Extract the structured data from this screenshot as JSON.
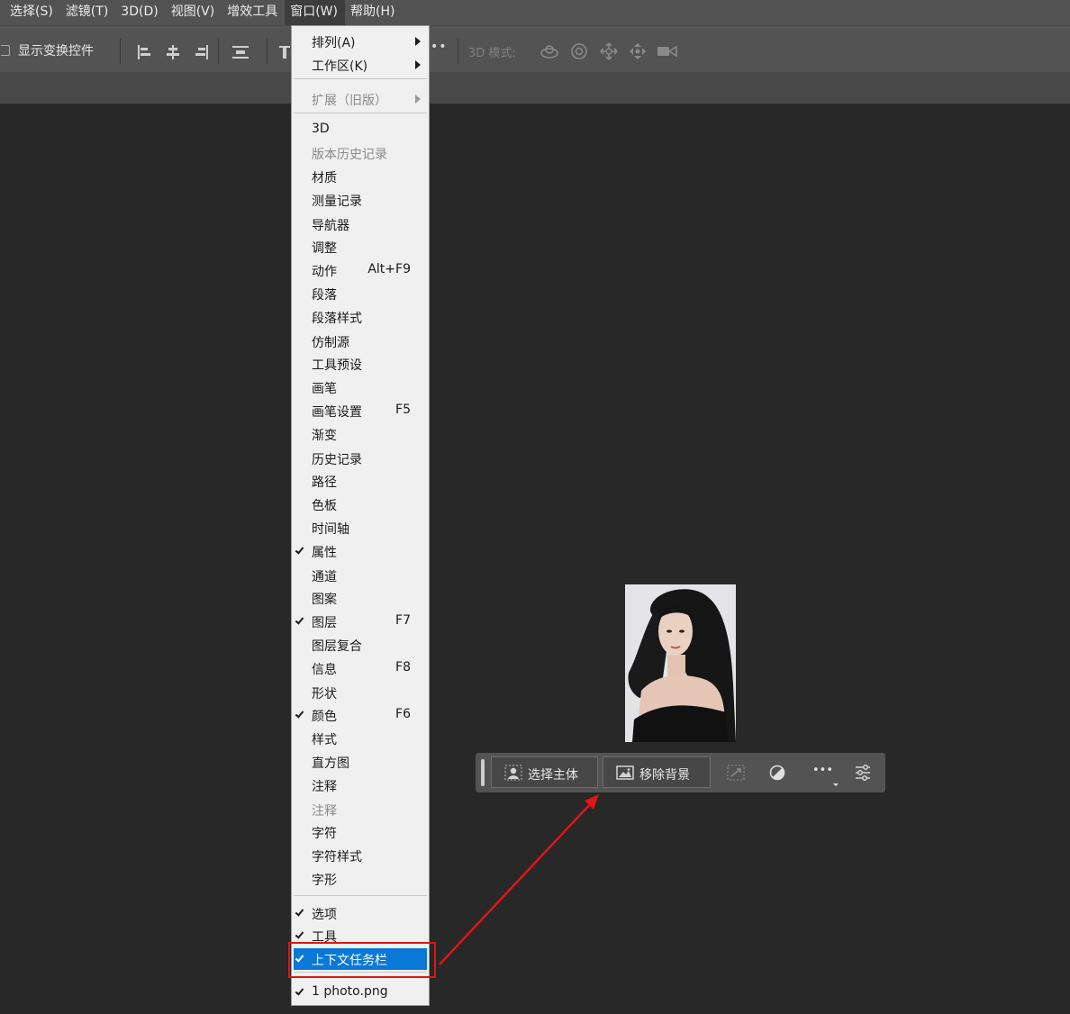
{
  "menubar": {
    "items": [
      "选择(S)",
      "滤镜(T)",
      "3D(D)",
      "视图(V)",
      "增效工具",
      "窗口(W)",
      "帮助(H)"
    ],
    "active_index": 5
  },
  "options_bar": {
    "show_transform_controls_label": "显示变换控件",
    "mode_label": "3D 模式:",
    "more_label": "••"
  },
  "window_menu": {
    "items": [
      {
        "label": "排列(A)",
        "submenu": true
      },
      {
        "label": "工作区(K)",
        "submenu": true
      },
      {
        "label": "扩展（旧版）",
        "submenu": true,
        "disabled": true
      },
      {
        "label": "3D"
      },
      {
        "label": "版本历史记录",
        "disabled": true
      },
      {
        "label": "材质"
      },
      {
        "label": "测量记录"
      },
      {
        "label": "导航器"
      },
      {
        "label": "调整"
      },
      {
        "label": "动作",
        "shortcut": "Alt+F9"
      },
      {
        "label": "段落"
      },
      {
        "label": "段落样式"
      },
      {
        "label": "仿制源"
      },
      {
        "label": "工具预设"
      },
      {
        "label": "画笔"
      },
      {
        "label": "画笔设置",
        "shortcut": "F5"
      },
      {
        "label": "渐变"
      },
      {
        "label": "历史记录"
      },
      {
        "label": "路径"
      },
      {
        "label": "色板"
      },
      {
        "label": "时间轴"
      },
      {
        "label": "属性",
        "checked": true
      },
      {
        "label": "通道"
      },
      {
        "label": "图案"
      },
      {
        "label": "图层",
        "checked": true,
        "shortcut": "F7"
      },
      {
        "label": "图层复合"
      },
      {
        "label": "信息",
        "shortcut": "F8"
      },
      {
        "label": "形状"
      },
      {
        "label": "颜色",
        "checked": true,
        "shortcut": "F6"
      },
      {
        "label": "样式"
      },
      {
        "label": "直方图"
      },
      {
        "label": "注释"
      },
      {
        "label": "注释",
        "disabled": true
      },
      {
        "label": "字符"
      },
      {
        "label": "字符样式"
      },
      {
        "label": "字形"
      },
      {
        "label": "选项",
        "checked": true
      },
      {
        "label": "工具",
        "checked": true
      },
      {
        "label": "上下文任务栏",
        "checked": true,
        "highlighted": true
      },
      {
        "label": "1 photo.png",
        "checked": true
      }
    ]
  },
  "context_taskbar": {
    "select_subject": "选择主体",
    "remove_background": "移除背景",
    "more_label": "•••"
  },
  "colors": {
    "highlight": "#0a78d7",
    "annotation_red": "#e01515",
    "app_background": "#282828",
    "panel": "#535353"
  }
}
